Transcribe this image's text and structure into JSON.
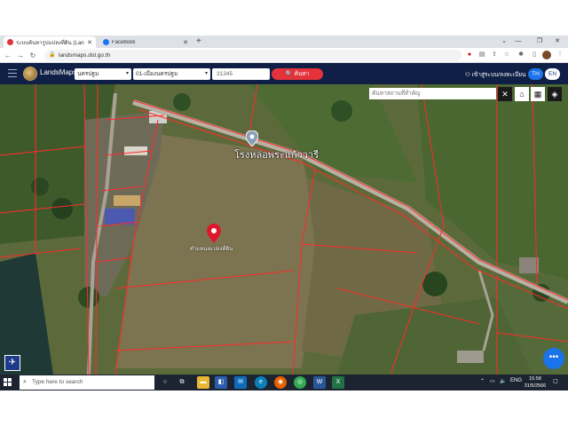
{
  "browser": {
    "tabs": [
      {
        "title": "ระบบค้นหารูปแปลงที่ดิน (LandsMaps)",
        "active": true,
        "favicon_color": "#e5333c"
      },
      {
        "title": "Facebook",
        "active": false,
        "favicon_color": "#1877f2"
      }
    ],
    "url": "landsmaps.dol.go.th"
  },
  "app": {
    "name": "LandsMaps",
    "province": "นครปฐม",
    "district": "01-เมืองนครปฐม",
    "parcel_no": "31345",
    "search_label": "ค้นหา",
    "login_label": "เข้าสู่ระบบ/ลงทะเบียน",
    "lang_th": "TH",
    "lang_en": "EN",
    "accent_color": "#e5333c",
    "header_color": "#0f1f45"
  },
  "map": {
    "place_search_placeholder": "ค้นหาสถานที่สำคัญ",
    "poi_label": "โรงหล่อพระแก้ววารี",
    "parcel_label": "ตำแหน่งแปลงที่ดิน"
  },
  "taskbar": {
    "search_placeholder": "Type here to search",
    "lang": "ENG",
    "time": "15:58",
    "date": "31/5/2566"
  }
}
